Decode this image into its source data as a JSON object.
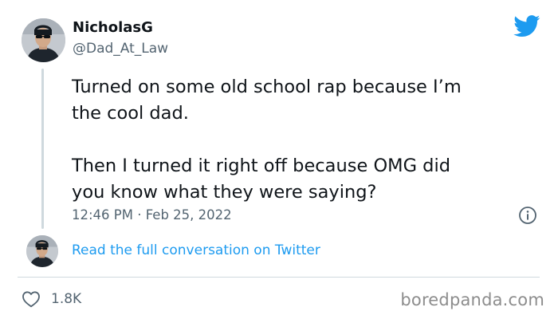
{
  "author": {
    "display_name": "NicholasG",
    "handle": "@Dad_At_Law"
  },
  "tweet": {
    "paragraphs": [
      {
        "line1": "Turned on some old school rap because I’m",
        "line2": "the cool dad."
      },
      {
        "line1": "Then I turned it right off because OMG did",
        "line2": "you know what they were saying?"
      }
    ],
    "timestamp": "12:46 PM · Feb 25, 2022"
  },
  "links": {
    "read_conversation": "Read the full conversation on Twitter"
  },
  "engagement": {
    "likes": "1.8K"
  },
  "watermark": "boredpanda.com",
  "icons": {
    "logo": "twitter-bird-icon",
    "info": "info-icon",
    "like": "heart-icon"
  },
  "colors": {
    "accent": "#1d9bf0",
    "text_primary": "#0f1419",
    "text_secondary": "#536471",
    "divider": "#cfd9de",
    "watermark": "#8d8d8d"
  }
}
